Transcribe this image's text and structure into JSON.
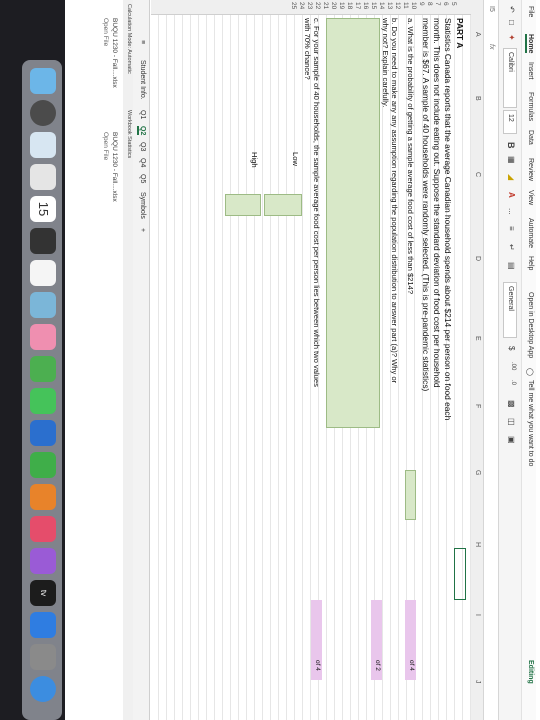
{
  "menu": {
    "items": [
      "File",
      "Home",
      "Insert",
      "Formulas",
      "Data",
      "Review",
      "View",
      "Automate",
      "Help"
    ],
    "open_desktop": "Open in Desktop App",
    "tell_me": "Tell me what you want to do",
    "editing": "Editing"
  },
  "ribbon": {
    "font_name": "Calibri",
    "font_size": "12",
    "bold": "B",
    "number_format": "General",
    "currency": "$",
    "more": "..."
  },
  "formula_bar": {
    "cell_ref": "I5",
    "fx": "fx"
  },
  "columns": [
    "A",
    "B",
    "C",
    "D",
    "E",
    "F",
    "G",
    "H",
    "I",
    "J"
  ],
  "rows": [
    "5",
    "6",
    "7",
    "8",
    "9",
    "10",
    "11",
    "12",
    "13",
    "14",
    "15",
    "16",
    "17",
    "18",
    "19",
    "20",
    "21",
    "22",
    "23",
    "24",
    "25"
  ],
  "sheet": {
    "part": "PART A",
    "line1": "Statistics Canada reports that the average Canadian household spends about $214 per person on food each",
    "line2": "month. This does not include eating out. Suppose the standard deviation of food cost per household",
    "line3": "member is $67. A sample of 40 households were randomly selected. (This is pre-pandemic statistics)",
    "q_a": "a. What is the probability of getting a sample average food cost of less than $214?",
    "q_b1": "b. Do you need to make any any assumption regarding the population distribution to answer part (a)? Why or",
    "q_b2": "why not? Explain carefully.",
    "q_c1": "c. For your sample of 40 households, the sample average food cost per person lies between which two values",
    "q_c2": "with 70% chance?",
    "low": "Low",
    "high": "High",
    "mark_a": "of 4",
    "mark_b": "of 2",
    "mark_c": "of 4"
  },
  "tabs": [
    "Student Info.",
    "Q1",
    "Q2",
    "Q3",
    "Q4",
    "Q5",
    "Symbols",
    "+"
  ],
  "status": {
    "calc_mode": "Calculation Mode: Automatic",
    "workbook_stats": "Workbook Statistics"
  },
  "files": [
    {
      "name": "BUQU 1230 - Fall....xlsx",
      "action": "Open File"
    },
    {
      "name": "BUQU 1230 - Fall....xlsx",
      "action": "Open File"
    }
  ],
  "dock": {
    "calendar_day": "15",
    "tv": "tv"
  }
}
